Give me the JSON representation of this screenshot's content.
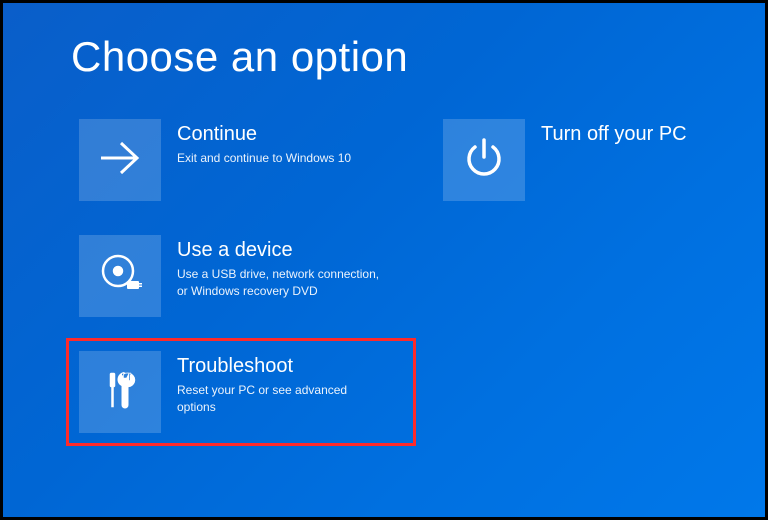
{
  "title": "Choose an option",
  "options": {
    "continue": {
      "title": "Continue",
      "desc": "Exit and continue to Windows 10"
    },
    "turnoff": {
      "title": "Turn off your PC",
      "desc": ""
    },
    "usedevice": {
      "title": "Use a device",
      "desc": "Use a USB drive, network connection, or Windows recovery DVD"
    },
    "troubleshoot": {
      "title": "Troubleshoot",
      "desc": "Reset your PC or see advanced options"
    }
  }
}
